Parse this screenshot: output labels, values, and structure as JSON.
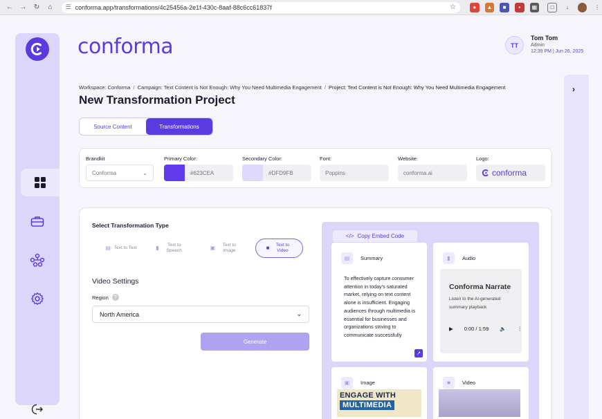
{
  "browser": {
    "url": "conforma.app/transformations/4c25456a-2e1f-430c-8aaf-88c6cc61837f"
  },
  "brand": {
    "name": "conforma",
    "color": "#5B3BE0"
  },
  "sidebar": {
    "items": [
      {
        "icon": "dashboard-icon"
      },
      {
        "icon": "briefcase-icon"
      },
      {
        "icon": "network-icon"
      },
      {
        "icon": "settings-icon"
      }
    ],
    "logout_icon": "logout-icon"
  },
  "user": {
    "initials": "TT",
    "name": "Tom Tom",
    "role": "Admin",
    "timestamp": "12:39 PM | Jun 26, 2025"
  },
  "breadcrumb": [
    "Workspace: Conforma",
    "Campaign: Text Content is Not Enough: Why You Need Multimedia Engagement",
    "Project: Text Content is Not Enough: Why You Need Multimedia Engagement"
  ],
  "page_title": "New Transformation Project",
  "tabs": [
    {
      "label": "Source Content",
      "active": false
    },
    {
      "label": "Transformations",
      "active": true
    }
  ],
  "brandkit": {
    "brandkit_label": "Brandkit",
    "brandkit_value": "Conforma",
    "primary_label": "Primary Color:",
    "primary_value": "#623CEA",
    "secondary_label": "Secondary Color:",
    "secondary_value": "#DFD9FB",
    "font_label": "Font:",
    "font_value": "Poppins",
    "website_label": "Website:",
    "website_value": "conforma.ai",
    "logo_label": "Logo:",
    "logo_text": "conforma"
  },
  "transform": {
    "section_title": "Select Transformation Type",
    "types": [
      {
        "label": "Text to Text",
        "icon": "document-icon",
        "active": false
      },
      {
        "label": "Text to Speech",
        "icon": "microphone-icon",
        "active": false
      },
      {
        "label": "Text to Image",
        "icon": "image-icon",
        "active": false
      },
      {
        "label": "Text to Video",
        "icon": "video-camera-icon",
        "active": true
      }
    ],
    "video_settings_title": "Video Settings",
    "region_label": "Region",
    "region_value": "North America",
    "generate_label": "Generate"
  },
  "preview": {
    "embed_label": "Copy Embed Code",
    "summary": {
      "title": "Summary",
      "text": "To effectively capture consumer attention in today's saturated market, relying on text content alone is insufficient. Engaging audiences through multimedia is essential for businesses and organizations striving to communicate successfully"
    },
    "audio": {
      "title": "Audio",
      "narrate_title": "Conforma Narrate",
      "narrate_sub": "Listen to the AI-generated summary playback",
      "time": "0:00 / 1:59"
    },
    "image": {
      "title": "Image",
      "line1": "ENGAGE WITH",
      "line2": "MULTIMEDIA"
    },
    "video": {
      "title": "Video"
    }
  }
}
